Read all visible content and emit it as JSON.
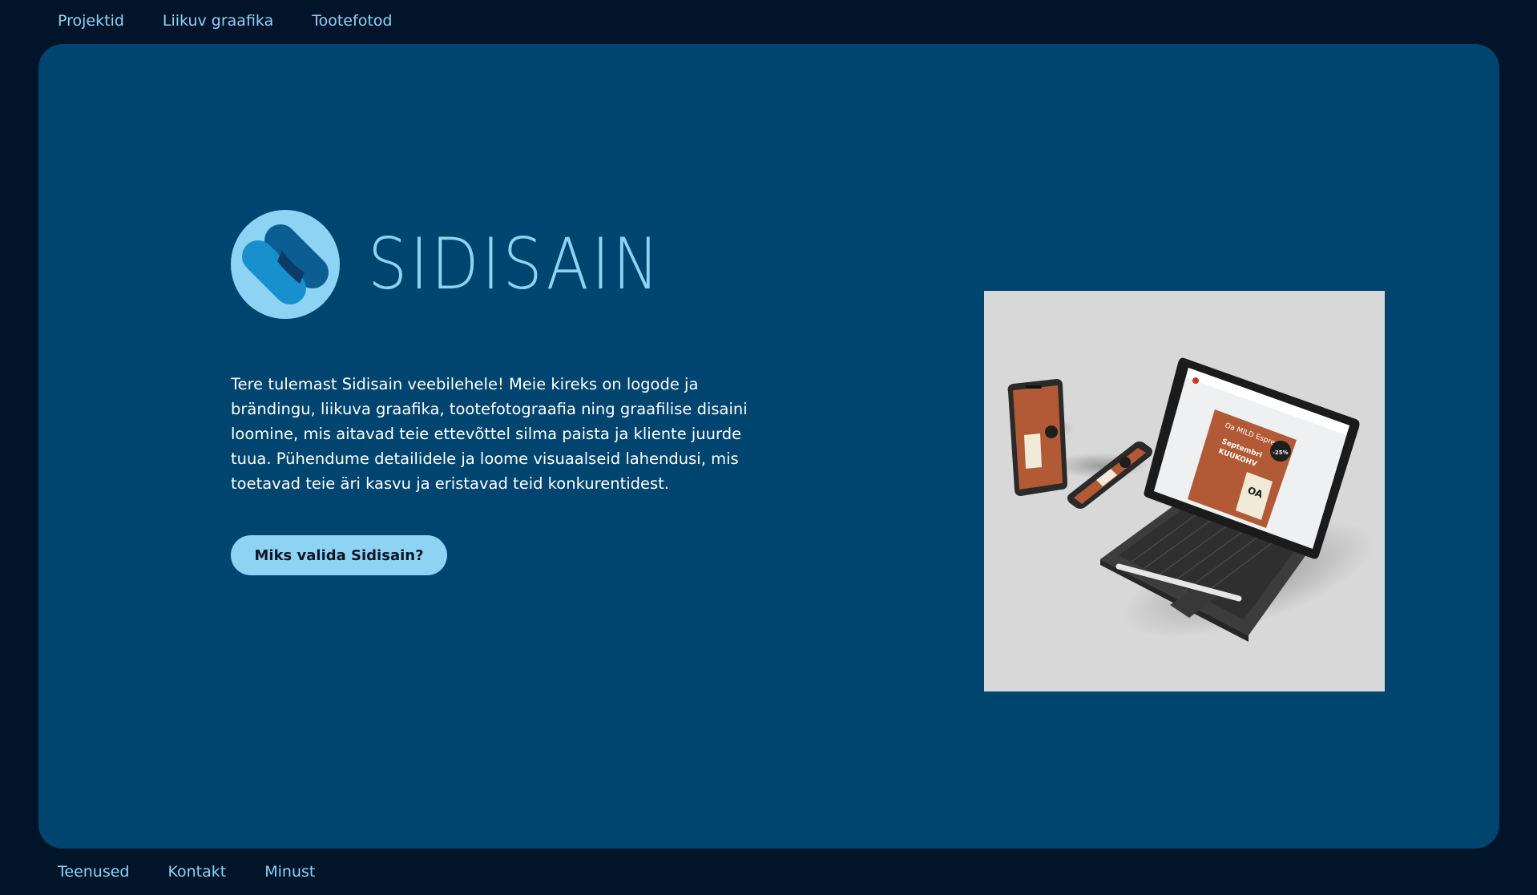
{
  "nav_top": [
    {
      "label": "Projektid"
    },
    {
      "label": "Liikuv graafika"
    },
    {
      "label": "Tootefotod"
    }
  ],
  "nav_bottom": [
    {
      "label": "Teenused"
    },
    {
      "label": "Kontakt"
    },
    {
      "label": "Minust"
    }
  ],
  "brand": {
    "name": "SIDISAIN"
  },
  "hero": {
    "intro": "Tere tulemast Sidisain veebilehele! Meie kireks on logode ja brändingu, liikuva graafika, tootefotograafia ning graafilise disaini loomine, mis aitavad teie ettevõttel silma paista ja kliente juurde tuua. Pühendume detailidele ja loome visuaalseid lahendusi, mis toetavad teie äri kasvu ja eristavad teid konkurentidest.",
    "cta_label": "Miks valida Sidisain?"
  },
  "mockup": {
    "tablet_headline": "Oa MILD Espresso",
    "promo_line1": "Septembri",
    "promo_line2": "KUUKOHV",
    "discount": "-25%",
    "product_brand": "OA"
  },
  "colors": {
    "page_background": "#01142a",
    "panel_background": "#004570",
    "accent": "#8fd3f4",
    "text": "#ffffff",
    "promo_orange": "#b25a35"
  }
}
